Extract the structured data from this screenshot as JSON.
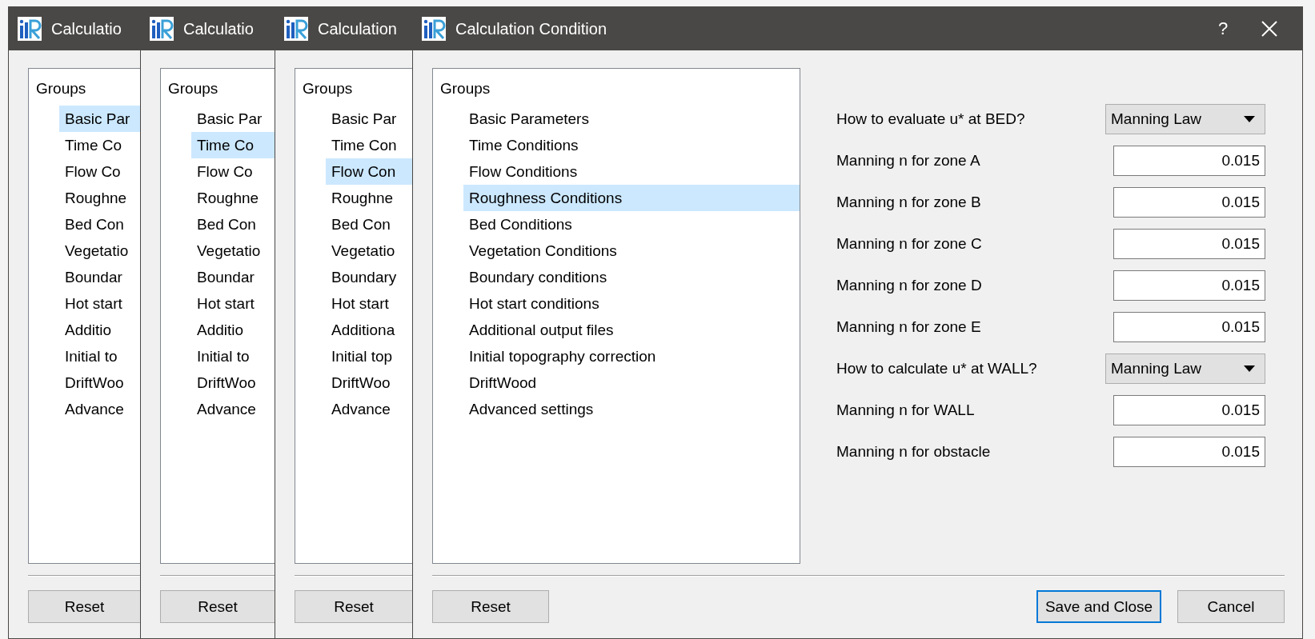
{
  "windows": [
    {
      "title": "Calculatio",
      "tree": {
        "header": "Groups",
        "items": [
          {
            "label": "Basic Par",
            "selected": true
          },
          {
            "label": "Time Co",
            "selected": false
          },
          {
            "label": "Flow Co",
            "selected": false
          },
          {
            "label": "Roughne",
            "selected": false
          },
          {
            "label": "Bed Con",
            "selected": false
          },
          {
            "label": "Vegetatio",
            "selected": false
          },
          {
            "label": "Boundar",
            "selected": false
          },
          {
            "label": "Hot start",
            "selected": false
          },
          {
            "label": "Additio",
            "selected": false
          },
          {
            "label": "Initial to",
            "selected": false
          },
          {
            "label": "DriftWoo",
            "selected": false
          },
          {
            "label": "Advance",
            "selected": false
          }
        ]
      },
      "buttons": [
        {
          "label": "Reset",
          "focused": false
        }
      ]
    },
    {
      "title": "Calculatio",
      "tree": {
        "header": "Groups",
        "items": [
          {
            "label": "Basic Par",
            "selected": false
          },
          {
            "label": "Time Co",
            "selected": true
          },
          {
            "label": "Flow Co",
            "selected": false
          },
          {
            "label": "Roughne",
            "selected": false
          },
          {
            "label": "Bed Con",
            "selected": false
          },
          {
            "label": "Vegetatio",
            "selected": false
          },
          {
            "label": "Boundar",
            "selected": false
          },
          {
            "label": "Hot start",
            "selected": false
          },
          {
            "label": "Additio",
            "selected": false
          },
          {
            "label": "Initial to",
            "selected": false
          },
          {
            "label": "DriftWoo",
            "selected": false
          },
          {
            "label": "Advance",
            "selected": false
          }
        ]
      },
      "buttons": [
        {
          "label": "Reset",
          "focused": false
        }
      ]
    },
    {
      "title": "Calculation",
      "tree": {
        "header": "Groups",
        "items": [
          {
            "label": "Basic Par",
            "selected": false
          },
          {
            "label": "Time Con",
            "selected": false
          },
          {
            "label": "Flow Con",
            "selected": true
          },
          {
            "label": "Roughne",
            "selected": false
          },
          {
            "label": "Bed Con",
            "selected": false
          },
          {
            "label": "Vegetatio",
            "selected": false
          },
          {
            "label": "Boundary",
            "selected": false
          },
          {
            "label": "Hot start",
            "selected": false
          },
          {
            "label": "Additiona",
            "selected": false
          },
          {
            "label": "Initial top",
            "selected": false
          },
          {
            "label": "DriftWoo",
            "selected": false
          },
          {
            "label": "Advance",
            "selected": false
          }
        ]
      },
      "buttons": [
        {
          "label": "Reset",
          "focused": false
        }
      ]
    },
    {
      "title": "Calculation Condition",
      "help": "?",
      "tree": {
        "header": "Groups",
        "items": [
          {
            "label": "Basic Parameters",
            "selected": false
          },
          {
            "label": "Time Conditions",
            "selected": false
          },
          {
            "label": "Flow Conditions",
            "selected": false
          },
          {
            "label": "Roughness Conditions",
            "selected": true
          },
          {
            "label": "Bed Conditions",
            "selected": false
          },
          {
            "label": "Vegetation Conditions",
            "selected": false
          },
          {
            "label": "Boundary conditions",
            "selected": false
          },
          {
            "label": "Hot start conditions",
            "selected": false
          },
          {
            "label": "Additional output files",
            "selected": false
          },
          {
            "label": "Initial topography correction",
            "selected": false
          },
          {
            "label": "DriftWood",
            "selected": false
          },
          {
            "label": "Advanced settings",
            "selected": false
          }
        ]
      },
      "form": [
        {
          "kind": "combo",
          "label": "How to evaluate u* at BED?",
          "value": "Manning Law"
        },
        {
          "kind": "number",
          "label": "Manning n for zone A",
          "value": "0.015"
        },
        {
          "kind": "number",
          "label": "Manning n for zone B",
          "value": "0.015"
        },
        {
          "kind": "number",
          "label": "Manning n for zone C",
          "value": "0.015"
        },
        {
          "kind": "number",
          "label": "Manning n for zone D",
          "value": "0.015"
        },
        {
          "kind": "number",
          "label": "Manning n for zone E",
          "value": "0.015"
        },
        {
          "kind": "combo",
          "label": "How to calculate u* at WALL?",
          "value": "Manning Law"
        },
        {
          "kind": "number",
          "label": "Manning n for WALL",
          "value": "0.015"
        },
        {
          "kind": "number",
          "label": "Manning n for obstacle",
          "value": "0.015"
        }
      ],
      "buttons": [
        {
          "label": "Reset",
          "focused": false
        },
        {
          "label": "Save and Close",
          "focused": true
        },
        {
          "label": "Cancel",
          "focused": false
        }
      ]
    }
  ]
}
